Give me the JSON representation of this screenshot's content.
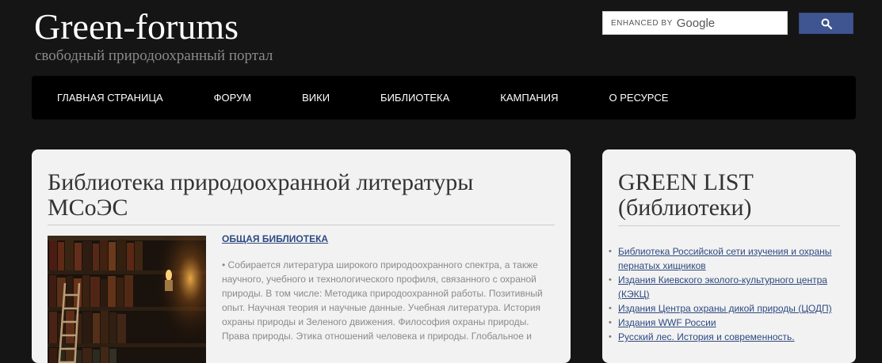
{
  "header": {
    "title": "Green-forums",
    "subtitle": "свободный природоохранный портал"
  },
  "search": {
    "enhanced_label": "ENHANCED BY",
    "brand_label": "Google",
    "button_icon": "search-icon"
  },
  "nav": {
    "items": [
      {
        "label": "ГЛАВНАЯ СТРАНИЦА"
      },
      {
        "label": "ФОРУМ"
      },
      {
        "label": "ВИКИ"
      },
      {
        "label": "БИБЛИОТЕКА"
      },
      {
        "label": "КАМПАНИЯ"
      },
      {
        "label": "О РЕСУРСЕ"
      }
    ]
  },
  "main": {
    "title": "Библиотека природоохранной литературы МСоЭС",
    "section_link": "ОБЩАЯ БИБЛИОТЕКА",
    "section_text": "Собирается литература широкого природоохранного спектра, а также научного, учебного и технологического профиля, связанного с охраной природы. В том числе: Методика природоохранной работы. Позитивный опыт. Научная теория и научные данные. Учебная литература. История охраны природы и Зеленого движения. Философия охраны природы. Права природы. Этика отношений человека и природы. Глобальное и"
  },
  "sidebar": {
    "title": "GREEN LIST (библиотеки)",
    "links": [
      {
        "label": "Библиотека Российской сети изучения и охраны пернатых хищников"
      },
      {
        "label": "Издания Киевского эколого-культурного центра (КЭКЦ)"
      },
      {
        "label": "Издания Центра охраны дикой природы (ЦОДП)"
      },
      {
        "label": "Издания WWF России"
      },
      {
        "label": "Русский лес. История и современность."
      }
    ]
  },
  "colors": {
    "background": "#151515",
    "nav_background": "#000000",
    "panel_background": "#f2f2f2",
    "link": "#2e4a82",
    "search_button": "#3e5591"
  }
}
